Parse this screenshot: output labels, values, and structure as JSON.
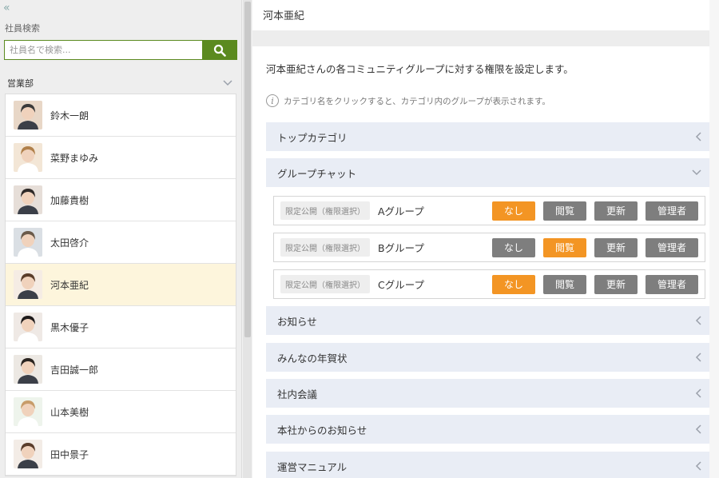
{
  "sidebar": {
    "collapse_glyph": "«",
    "search_label": "社員検索",
    "search_placeholder": "社員名で検索...",
    "department": "営業部",
    "employees": [
      {
        "name": "鈴木一朗",
        "selected": false
      },
      {
        "name": "菜野まゆみ",
        "selected": false
      },
      {
        "name": "加藤貴樹",
        "selected": false
      },
      {
        "name": "太田啓介",
        "selected": false
      },
      {
        "name": "河本亜紀",
        "selected": true
      },
      {
        "name": "黒木優子",
        "selected": false
      },
      {
        "name": "吉田誠一郎",
        "selected": false
      },
      {
        "name": "山本美樹",
        "selected": false
      },
      {
        "name": "田中景子",
        "selected": false
      }
    ]
  },
  "main": {
    "title": "河本亜紀",
    "description": "河本亜紀さんの各コミュニティグループに対する権限を設定します。",
    "hint": "カテゴリ名をクリックすると、カテゴリ内のグループが表示されます。",
    "categories": [
      {
        "label": "トップカテゴリ",
        "expanded": false
      },
      {
        "label": "グループチャット",
        "expanded": true
      },
      {
        "label": "お知らせ",
        "expanded": false
      },
      {
        "label": "みんなの年賀状",
        "expanded": false
      },
      {
        "label": "社内会議",
        "expanded": false
      },
      {
        "label": "本社からのお知らせ",
        "expanded": false
      },
      {
        "label": "運営マニュアル",
        "expanded": false
      }
    ],
    "groups": [
      {
        "tag": "限定公開（権限選択）",
        "name": "Aグループ",
        "active": "none"
      },
      {
        "tag": "限定公開（権限選択）",
        "name": "Bグループ",
        "active": "view"
      },
      {
        "tag": "限定公開（権限選択）",
        "name": "Cグループ",
        "active": "none"
      }
    ],
    "permission_labels": {
      "none": "なし",
      "view": "閲覧",
      "update": "更新",
      "admin": "管理者"
    }
  },
  "colors": {
    "accent_green": "#5b8a1f",
    "active_orange": "#f39524",
    "inactive_gray": "#7e7e7e",
    "selected_row": "#fdf5dc",
    "category_bg": "#e9edf5"
  },
  "icons": {
    "search": "search-icon",
    "info": "info-icon",
    "collapse": "chevron-down-icon",
    "expand": "chevron-left-icon"
  }
}
